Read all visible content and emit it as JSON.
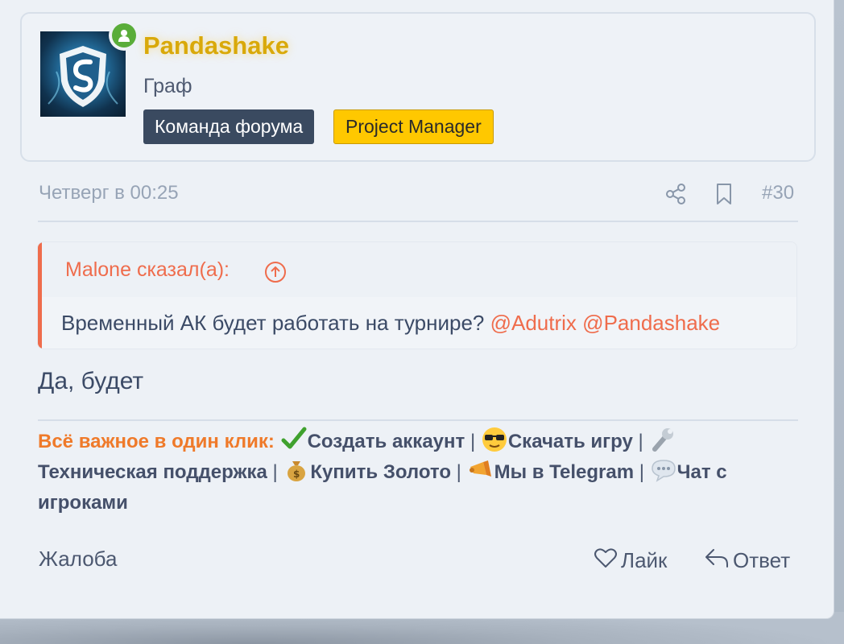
{
  "user": {
    "name": "Pandashake",
    "title": "Граф",
    "badges": [
      "Команда форума",
      "Project Manager"
    ],
    "online_icon": "user-online-icon"
  },
  "meta": {
    "date": "Четверг в 00:25",
    "post_number": "#30"
  },
  "quote": {
    "author": "Malone сказал(а):",
    "text": "Временный АК будет работать на турнире?",
    "mentions": [
      "@Adutrix",
      "@Pandashake"
    ]
  },
  "reply_text": "Да, будет",
  "signature": {
    "lead": "Всё важное в один клик:",
    "links": [
      {
        "label": "Создать аккаунт",
        "icon": "check-mark-emoji"
      },
      {
        "label": "Скачать игру",
        "icon": "sunglasses-emoji"
      },
      {
        "label": "Техническая поддержка",
        "icon": "wrench-emoji"
      },
      {
        "label": "Купить Золото",
        "icon": "money-bag-emoji"
      },
      {
        "label": "Мы в Telegram",
        "icon": "megaphone-emoji"
      },
      {
        "label": "Чат с игроками",
        "icon": "speech-bubble-emoji"
      }
    ],
    "separator": "|"
  },
  "actions": {
    "report": "Жалоба",
    "like": "Лайк",
    "reply": "Ответ"
  },
  "colors": {
    "accent": "#ef6c4c",
    "username": "#d9a90a",
    "badge_team": "#3a4a60",
    "badge_pm": "#ffc800"
  }
}
